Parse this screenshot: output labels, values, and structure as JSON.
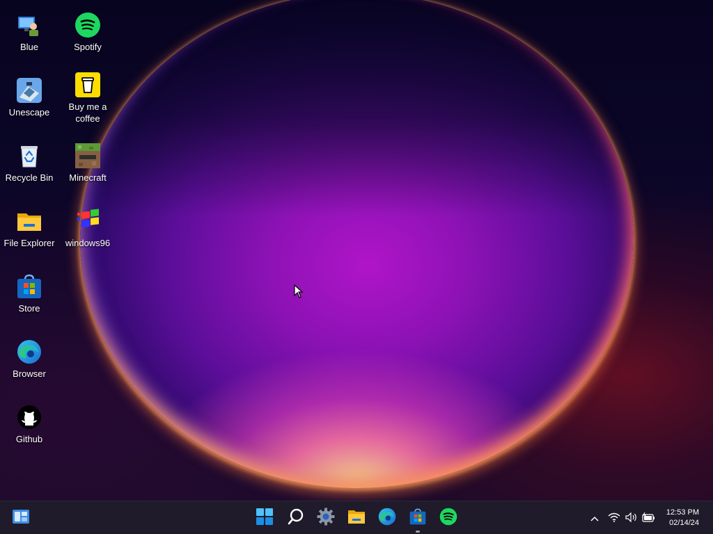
{
  "desktop": {
    "icons": [
      {
        "name": "desktop-icon-blue",
        "label": "Blue"
      },
      {
        "name": "desktop-icon-spotify",
        "label": "Spotify"
      },
      {
        "name": "desktop-icon-unescape",
        "label": "Unescape"
      },
      {
        "name": "desktop-icon-buy-me-a-coffee",
        "label": "Buy me a coffee"
      },
      {
        "name": "desktop-icon-recycle-bin",
        "label": "Recycle Bin"
      },
      {
        "name": "desktop-icon-minecraft",
        "label": "Minecraft"
      },
      {
        "name": "desktop-icon-file-explorer",
        "label": "File Explorer"
      },
      {
        "name": "desktop-icon-windows96",
        "label": "windows96"
      },
      {
        "name": "desktop-icon-store",
        "label": "Store"
      },
      {
        "name": "desktop-icon-browser",
        "label": "Browser"
      },
      {
        "name": "desktop-icon-github",
        "label": "Github"
      }
    ]
  },
  "taskbar": {
    "pinned": [
      "widgets-icon",
      "start-icon",
      "search-icon",
      "settings-icon",
      "file-explorer-icon",
      "edge-icon",
      "store-icon",
      "spotify-icon"
    ],
    "tray": [
      "chevron-up-icon",
      "wifi-icon",
      "volume-icon",
      "battery-icon"
    ],
    "clock": {
      "time": "12:53 PM",
      "date": "02/14/24"
    }
  },
  "colors": {
    "taskbar": "#1f1b2a",
    "accent": "#0078d4",
    "spotify": "#1ed760"
  }
}
